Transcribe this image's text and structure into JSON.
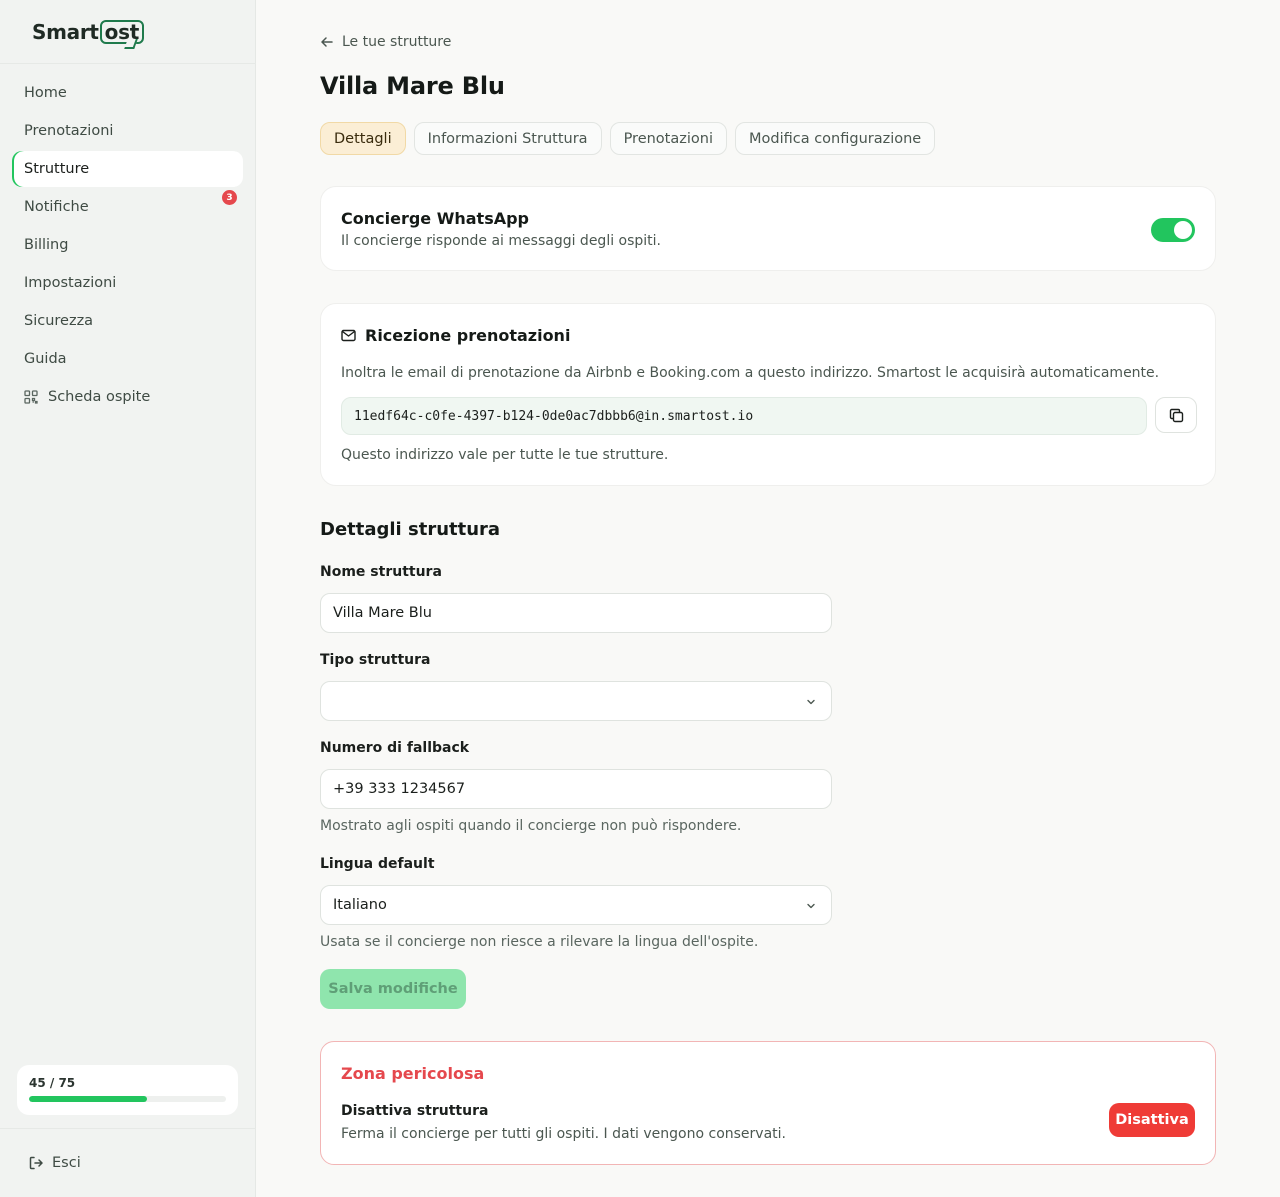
{
  "brand": {
    "name_prefix": "Smart",
    "name_suffix": "ost",
    "accent": "#22c55e",
    "logo_color": "#1f7a4c"
  },
  "sidebar": {
    "items": [
      {
        "label": "Home"
      },
      {
        "label": "Prenotazioni"
      },
      {
        "label": "Strutture",
        "active": true
      },
      {
        "label": "Notifiche",
        "badge": "3"
      },
      {
        "label": "Billing"
      },
      {
        "label": "Impostazioni"
      },
      {
        "label": "Sicurezza"
      },
      {
        "label": "Guida"
      },
      {
        "label": "Scheda ospite",
        "icon": "qr-code-icon"
      }
    ],
    "usage": {
      "label": "45 / 75",
      "used": 45,
      "total": 75
    },
    "logout_label": "Esci"
  },
  "header": {
    "back_label": "Le tue strutture",
    "title": "Villa Mare Blu",
    "tabs": [
      {
        "label": "Dettagli",
        "active": true
      },
      {
        "label": "Informazioni Struttura"
      },
      {
        "label": "Prenotazioni"
      },
      {
        "label": "Modifica configurazione"
      }
    ]
  },
  "whatsapp": {
    "title": "Concierge WhatsApp",
    "subtitle": "Il concierge risponde ai messaggi degli ospiti.",
    "enabled": true
  },
  "booking_email": {
    "title": "Ricezione prenotazioni",
    "description": "Inoltra le email di prenotazione da Airbnb e Booking.com a questo indirizzo. Smartost le acquisirà automaticamente.",
    "address": "11edf64c-c0fe-4397-b124-0de0ac7dbbb6@in.smartost.io",
    "note": "Questo indirizzo vale per tutte le tue strutture."
  },
  "details": {
    "section_title": "Dettagli struttura",
    "name_label": "Nome struttura",
    "name_value": "Villa Mare Blu",
    "type_label": "Tipo struttura",
    "type_value": "",
    "fallback_label": "Numero di fallback",
    "fallback_value": "+39 333 1234567",
    "fallback_hint": "Mostrato agli ospiti quando il concierge non può rispondere.",
    "language_label": "Lingua default",
    "language_value": "Italiano",
    "language_hint": "Usata se il concierge non riesce a rilevare la lingua dell'ospite.",
    "save_label": "Salva modifiche"
  },
  "danger": {
    "title": "Zona pericolosa",
    "action_title": "Disattiva struttura",
    "action_desc": "Ferma il concierge per tutti gli ospiti. I dati vengono conservati.",
    "button_label": "Disattiva",
    "color": "#e5484d"
  }
}
